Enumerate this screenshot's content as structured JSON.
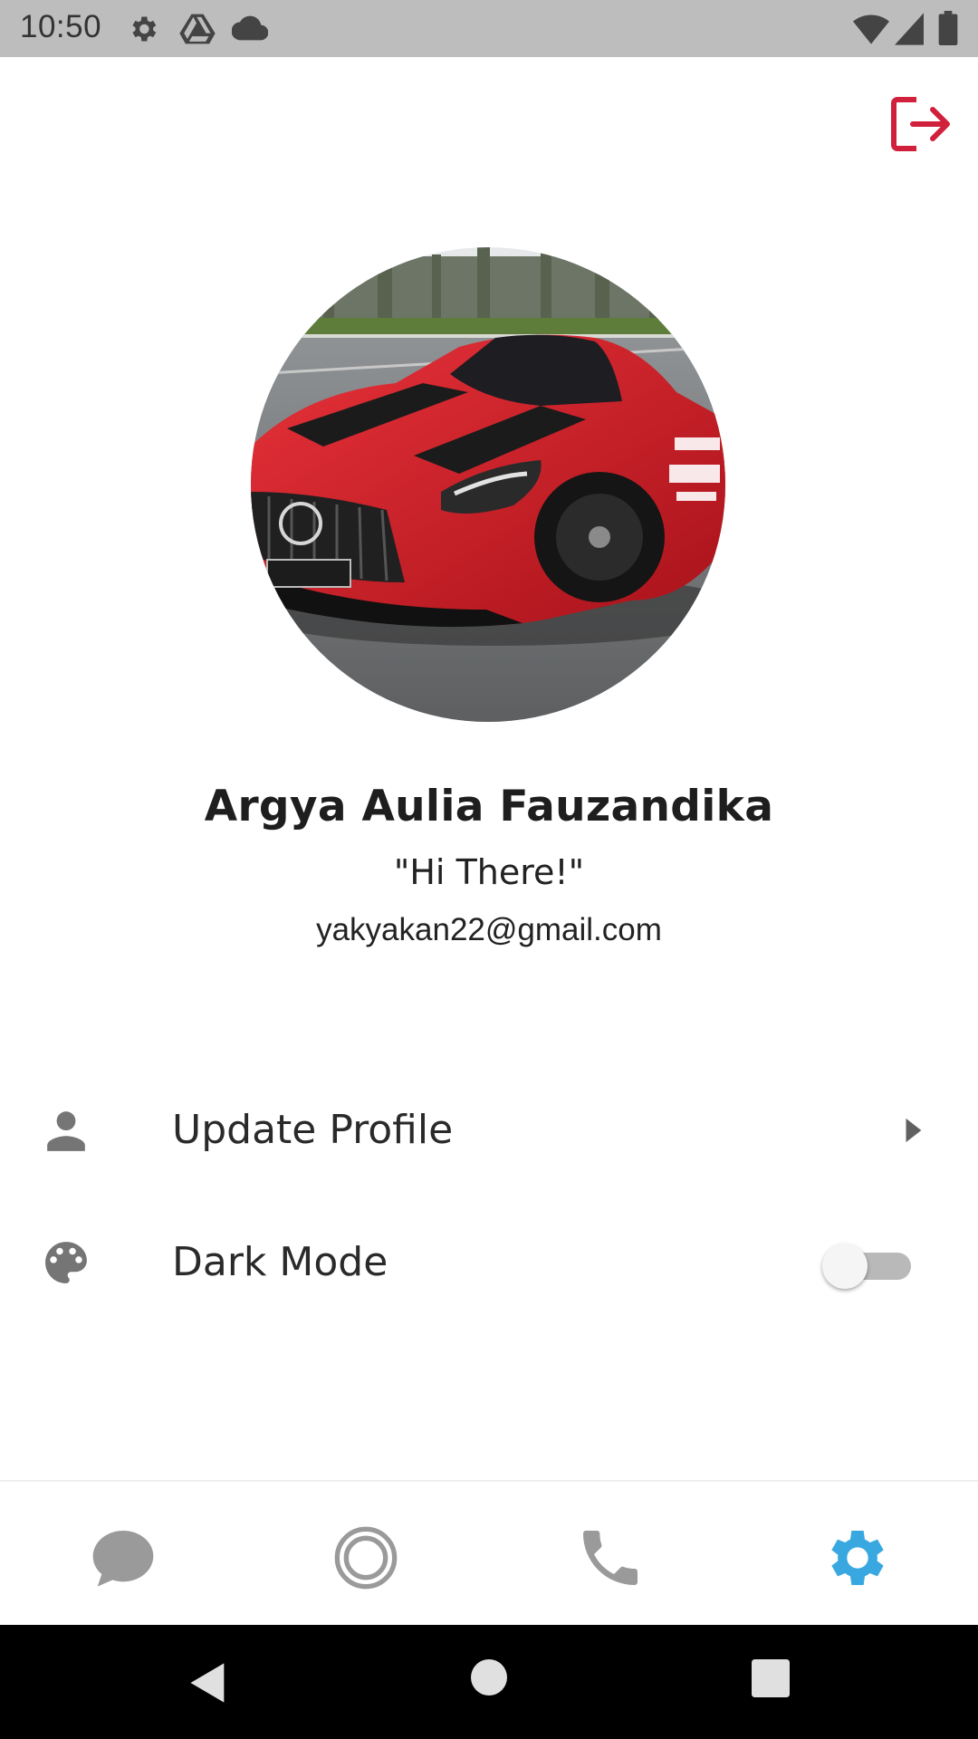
{
  "status_bar": {
    "time": "10:50",
    "icons": [
      "settings-icon",
      "drive-icon",
      "cloud-icon",
      "wifi-icon",
      "signal-icon",
      "battery-icon"
    ]
  },
  "header": {
    "logout_icon": "logout-icon",
    "accent_color": "#d0203c"
  },
  "profile": {
    "name": "Argya Aulia Fauzandika",
    "status": "\"Hi There!\"",
    "email": "yakyakan22@gmail.com",
    "avatar_description_icon": "avatar-image"
  },
  "settings": {
    "items": [
      {
        "label": "Update Profile",
        "icon": "person-icon",
        "trailing": "chevron-right-icon"
      },
      {
        "label": "Dark Mode",
        "icon": "palette-icon",
        "trailing": "toggle",
        "toggle_on": false
      }
    ]
  },
  "bottom_nav": {
    "items": [
      {
        "icon": "chat-icon",
        "active": false
      },
      {
        "icon": "status-icon",
        "active": false
      },
      {
        "icon": "phone-icon",
        "active": false
      },
      {
        "icon": "settings-icon",
        "active": true
      }
    ],
    "active_color": "#3aa8e0",
    "inactive_color": "#9a9a9a"
  },
  "system_nav": {
    "items": [
      "back-icon",
      "home-icon",
      "recents-icon"
    ]
  }
}
